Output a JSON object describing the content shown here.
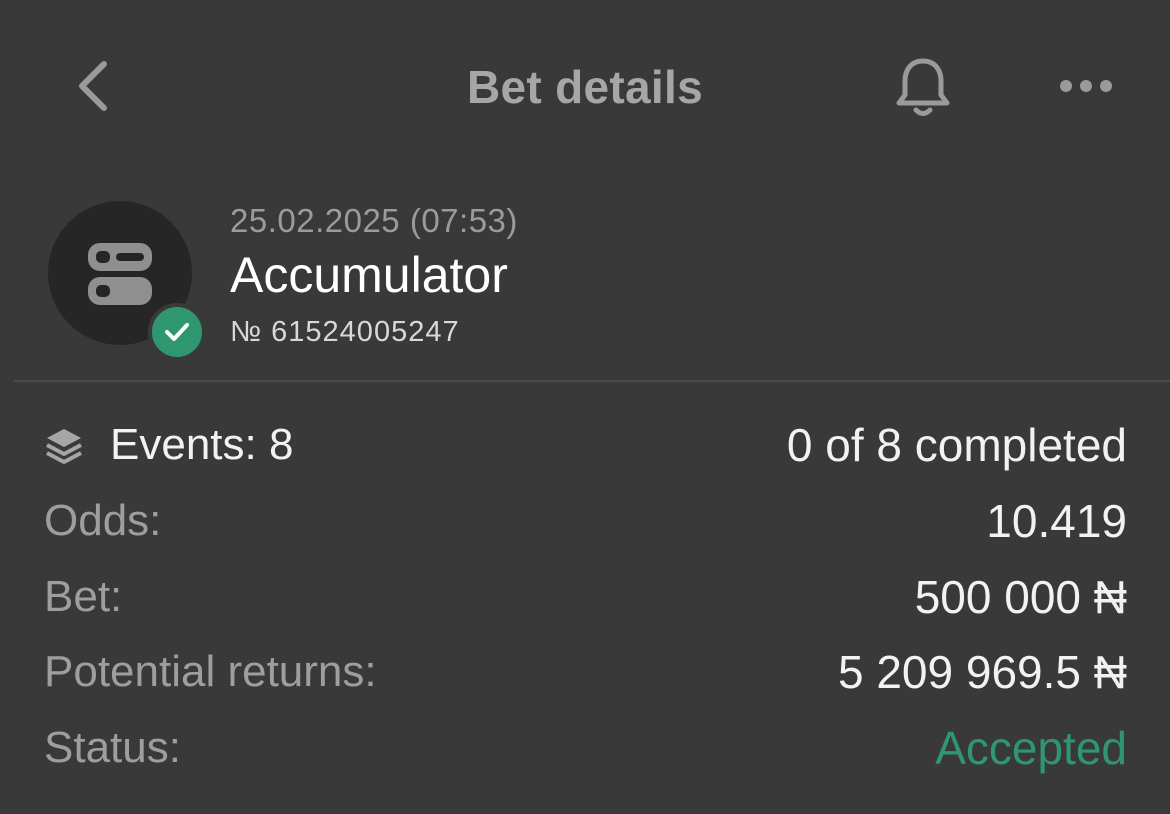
{
  "header": {
    "title": "Bet details",
    "back_icon": "chevron-left-icon",
    "bell_icon": "bell-icon",
    "more_icon": "more-horizontal-icon"
  },
  "bet": {
    "date": "25.02.2025 (07:53)",
    "type": "Accumulator",
    "number": "№ 61524005247",
    "status_icon": "check-icon",
    "type_icon": "accumulator-icon"
  },
  "details": {
    "events_label": "Events: 8",
    "events_value": "0 of 8 completed",
    "odds_label": "Odds:",
    "odds_value": "10.419",
    "bet_label": "Bet:",
    "bet_value": "500 000 ₦",
    "returns_label": "Potential returns:",
    "returns_value": "5 209 969.5 ₦",
    "status_label": "Status:",
    "status_value": "Accepted"
  },
  "colors": {
    "background": "#393939",
    "accent_green": "#2f9770",
    "muted_text": "#9e9e9e"
  }
}
